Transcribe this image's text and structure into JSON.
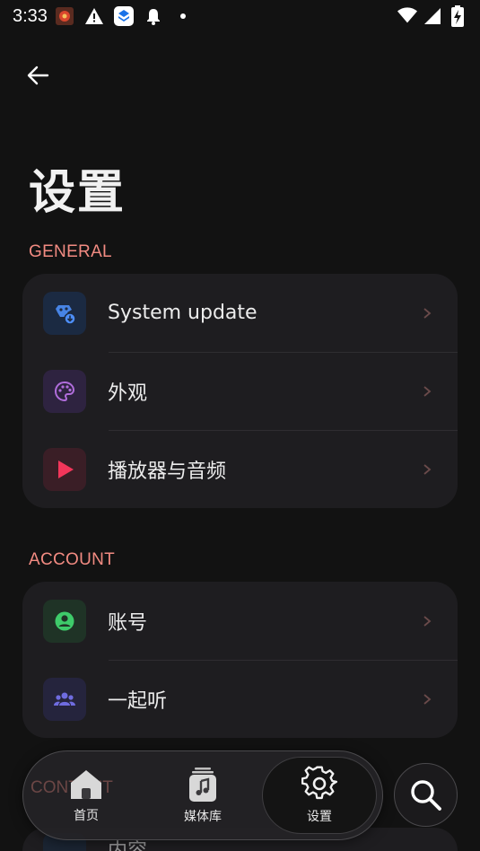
{
  "status_bar": {
    "time": "3:33",
    "left_icons": [
      "app-notification-icon",
      "warning-icon",
      "layers-app-icon",
      "bell-icon",
      "dot-icon"
    ],
    "right_icons": [
      "wifi-icon",
      "signal-icon",
      "battery-charging-icon"
    ]
  },
  "header": {
    "title": "设置"
  },
  "sections": {
    "general": {
      "title": "GENERAL",
      "items": [
        {
          "label": "System update",
          "icon": "system-update-icon",
          "icon_bg": "#1b2a42",
          "icon_color": "#4d8ef7"
        },
        {
          "label": "外观",
          "icon": "palette-icon",
          "icon_bg": "#2e2340",
          "icon_color": "#b06ddb"
        },
        {
          "label": "播放器与音频",
          "icon": "play-icon",
          "icon_bg": "#3a1e26",
          "icon_color": "#f2365a"
        }
      ]
    },
    "account": {
      "title": "ACCOUNT",
      "items": [
        {
          "label": "账号",
          "icon": "account-circle-icon",
          "icon_bg": "#1f3326",
          "icon_color": "#3ecb6a"
        },
        {
          "label": "一起听",
          "icon": "group-icon",
          "icon_bg": "#25243d",
          "icon_color": "#6f6ce0"
        }
      ]
    },
    "content": {
      "title": "CONTENT",
      "first_item_label": "内容"
    }
  },
  "nav": {
    "items": [
      {
        "label": "首页",
        "icon": "home-icon"
      },
      {
        "label": "媒体库",
        "icon": "library-music-icon"
      },
      {
        "label": "设置",
        "icon": "gear-icon"
      }
    ],
    "active_index": 2
  },
  "colors": {
    "background": "#121212",
    "card": "#1e1d20",
    "accent": "#f28b82",
    "chevron": "#6a4a4a"
  }
}
